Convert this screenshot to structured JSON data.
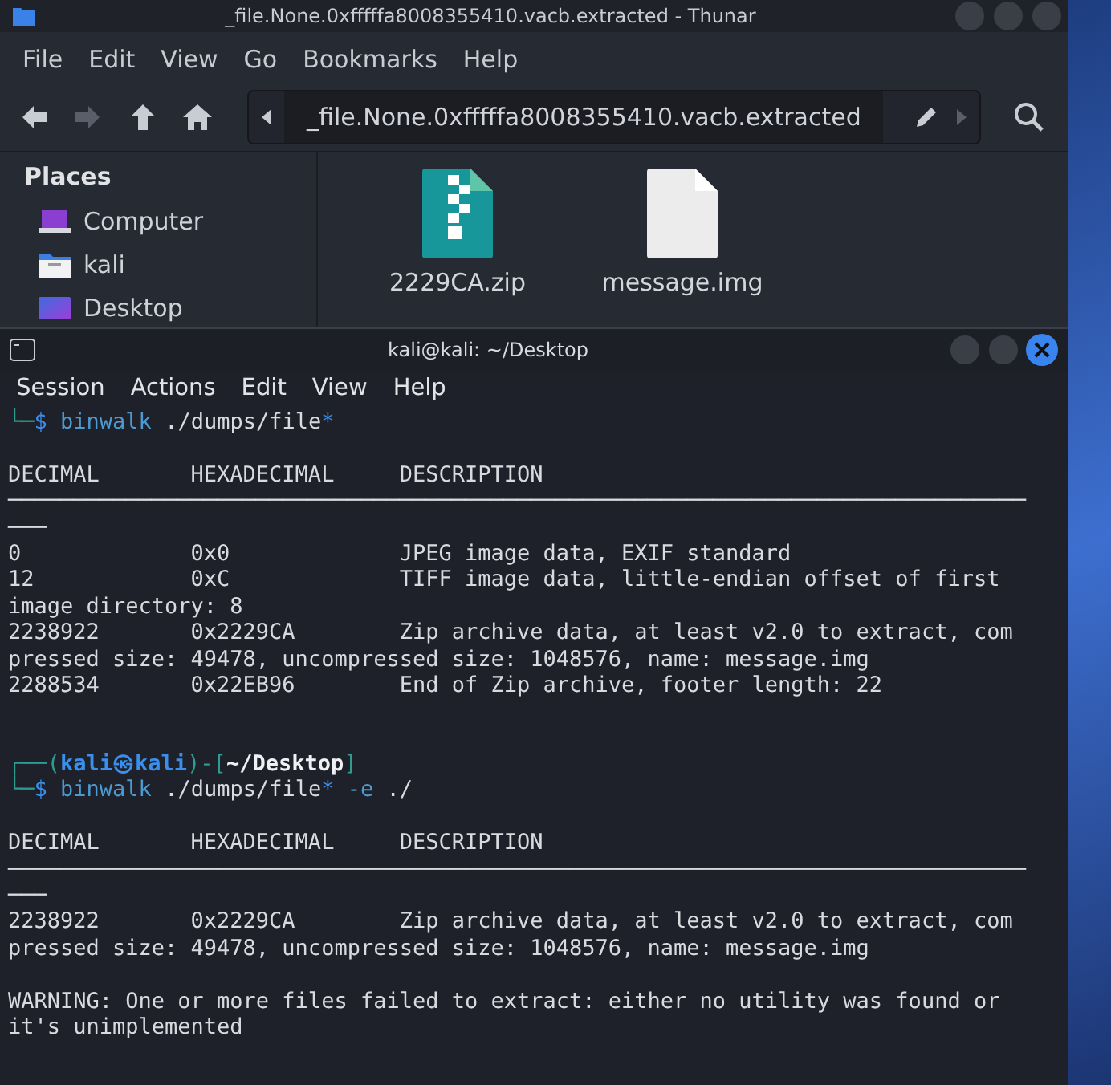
{
  "thunar": {
    "title": "_file.None.0xfffffa8008355410.vacb.extracted - Thunar",
    "menu": [
      "File",
      "Edit",
      "View",
      "Go",
      "Bookmarks",
      "Help"
    ],
    "nav_buttons": [
      {
        "kind": "back",
        "disabled": false
      },
      {
        "kind": "forward",
        "disabled": true
      },
      {
        "kind": "up",
        "disabled": false
      },
      {
        "kind": "home",
        "disabled": false
      }
    ],
    "location": "_file.None.0xfffffa8008355410.vacb.extracted",
    "sidebar": {
      "heading": "Places",
      "items": [
        {
          "kind": "computer",
          "label": "Computer"
        },
        {
          "kind": "home",
          "label": "kali"
        },
        {
          "kind": "desktop",
          "label": "Desktop"
        }
      ]
    },
    "files": [
      {
        "kind": "zip",
        "name": "2229CA.zip"
      },
      {
        "kind": "document",
        "name": "message.img"
      }
    ]
  },
  "terminal": {
    "title": "kali@kali: ~/Desktop",
    "menu": [
      "Session",
      "Actions",
      "Edit",
      "View",
      "Help"
    ],
    "lines": [
      {
        "kind": "prompt",
        "segments": [
          {
            "kind": "frame",
            "text": "└─"
          },
          {
            "kind": "dollar",
            "text": "$"
          },
          {
            "kind": "command",
            "text": " binwalk"
          },
          {
            "kind": "plain",
            "text": " ./dumps/file"
          },
          {
            "kind": "glob",
            "text": "*"
          }
        ]
      },
      {
        "kind": "blank"
      },
      {
        "kind": "output",
        "text": "DECIMAL       HEXADECIMAL     DESCRIPTION"
      },
      {
        "kind": "output",
        "text": "──────────────────────────────────────────────────────────────────────────────"
      },
      {
        "kind": "output",
        "text": "───"
      },
      {
        "kind": "output",
        "text": "0             0x0             JPEG image data, EXIF standard"
      },
      {
        "kind": "output",
        "text": "12            0xC             TIFF image data, little-endian offset of first"
      },
      {
        "kind": "output",
        "text": "image directory: 8"
      },
      {
        "kind": "output",
        "text": "2238922       0x2229CA        Zip archive data, at least v2.0 to extract, com"
      },
      {
        "kind": "output",
        "text": "pressed size: 49478, uncompressed size: 1048576, name: message.img"
      },
      {
        "kind": "output",
        "text": "2288534       0x22EB96        End of Zip archive, footer length: 22"
      },
      {
        "kind": "blank"
      },
      {
        "kind": "blank"
      },
      {
        "kind": "prompt",
        "segments": [
          {
            "kind": "frame",
            "text": "┌──("
          },
          {
            "kind": "user",
            "text": "kali㉿kali"
          },
          {
            "kind": "frame",
            "text": ")-["
          },
          {
            "kind": "path",
            "text": "~/Desktop"
          },
          {
            "kind": "frame",
            "text": "]"
          }
        ]
      },
      {
        "kind": "prompt",
        "segments": [
          {
            "kind": "frame",
            "text": "└─"
          },
          {
            "kind": "dollar",
            "text": "$"
          },
          {
            "kind": "command",
            "text": " binwalk"
          },
          {
            "kind": "plain",
            "text": " ./dumps/file"
          },
          {
            "kind": "glob",
            "text": "*"
          },
          {
            "kind": "option",
            "text": " -e"
          },
          {
            "kind": "plain",
            "text": " ./"
          }
        ]
      },
      {
        "kind": "blank"
      },
      {
        "kind": "output",
        "text": "DECIMAL       HEXADECIMAL     DESCRIPTION"
      },
      {
        "kind": "output",
        "text": "──────────────────────────────────────────────────────────────────────────────"
      },
      {
        "kind": "output",
        "text": "───"
      },
      {
        "kind": "output",
        "text": "2238922       0x2229CA        Zip archive data, at least v2.0 to extract, com"
      },
      {
        "kind": "output",
        "text": "pressed size: 49478, uncompressed size: 1048576, name: message.img"
      },
      {
        "kind": "blank"
      },
      {
        "kind": "output",
        "text": "WARNING: One or more files failed to extract: either no utility was found or"
      },
      {
        "kind": "output",
        "text": "it's unimplemented"
      }
    ]
  }
}
